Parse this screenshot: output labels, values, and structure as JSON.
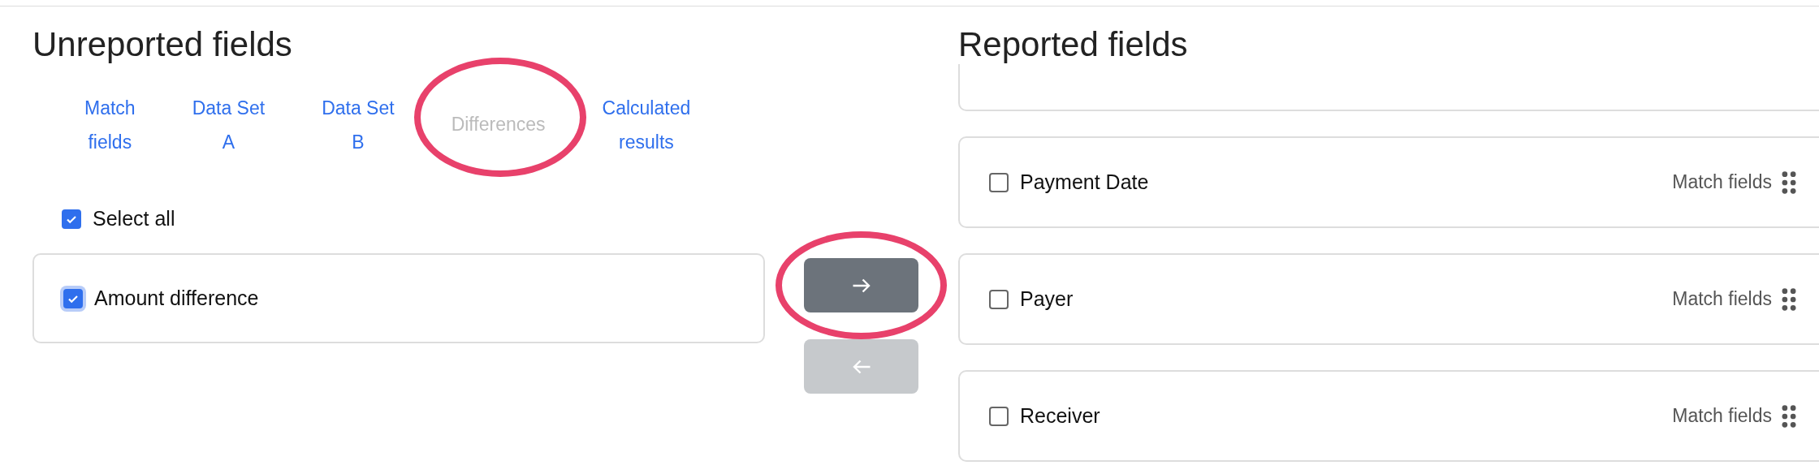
{
  "unreported": {
    "title": "Unreported fields",
    "tabs": [
      {
        "label": "Match\nfields",
        "disabled": false,
        "circled": false
      },
      {
        "label": "Data Set\nA",
        "disabled": false,
        "circled": false
      },
      {
        "label": "Data Set\nB",
        "disabled": false,
        "circled": false
      },
      {
        "label": "Differences",
        "disabled": true,
        "circled": true
      },
      {
        "label": "Calculated\nresults",
        "disabled": false,
        "circled": false
      }
    ],
    "select_all": {
      "label": "Select all",
      "checked": true
    },
    "fields": [
      {
        "label": "Amount difference",
        "checked": true
      }
    ]
  },
  "move_buttons": [
    {
      "kind": "right",
      "disabled": false,
      "circled": true
    },
    {
      "kind": "left",
      "disabled": true,
      "circled": false
    }
  ],
  "reported": {
    "title": "Reported fields",
    "fields": [
      {
        "label": "Payment Date",
        "checked": false,
        "tag": "Match fields"
      },
      {
        "label": "Payer",
        "checked": false,
        "tag": "Match fields"
      },
      {
        "label": "Receiver",
        "checked": false,
        "tag": "Match fields"
      }
    ]
  }
}
